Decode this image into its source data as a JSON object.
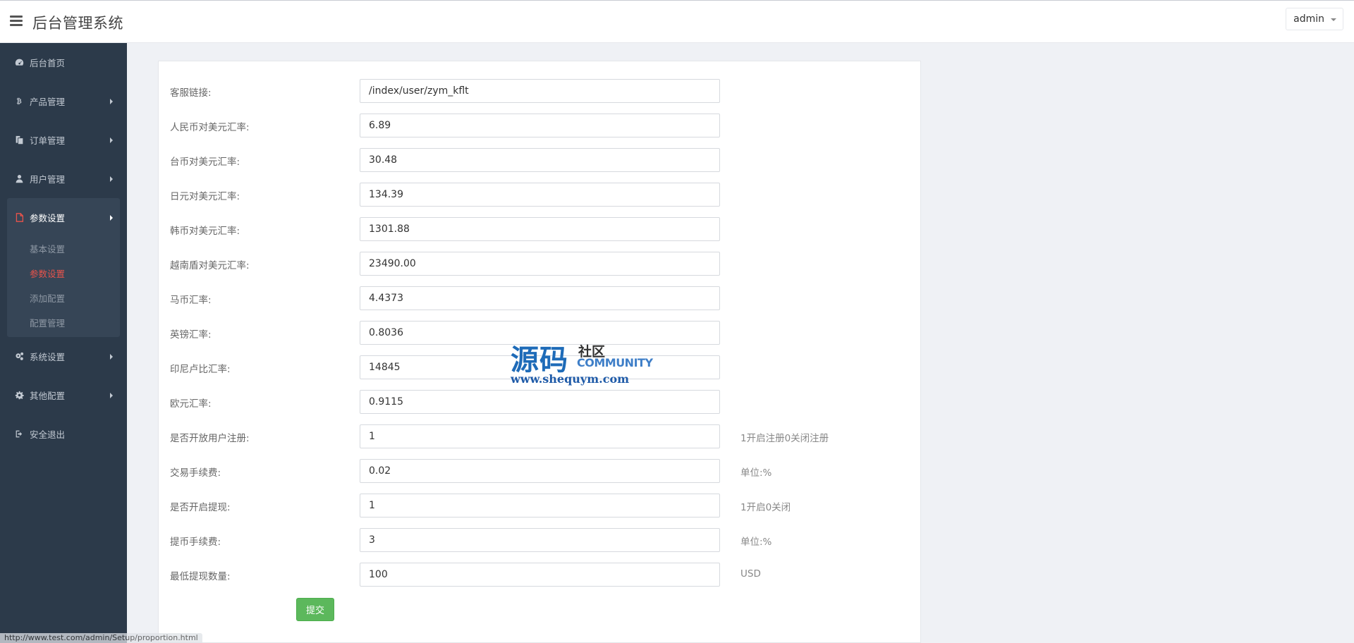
{
  "header": {
    "title": "后台管理系统",
    "user": "admin"
  },
  "sidebar": {
    "items": [
      {
        "label": "后台首页",
        "icon": "dashboard-icon",
        "has_arrow": false
      },
      {
        "label": "产品管理",
        "icon": "bitcoin-icon",
        "has_arrow": true
      },
      {
        "label": "订单管理",
        "icon": "copy-icon",
        "has_arrow": true
      },
      {
        "label": "用户管理",
        "icon": "user-icon",
        "has_arrow": true
      }
    ],
    "active_group": {
      "label": "参数设置",
      "icon": "file-icon",
      "subitems": [
        {
          "label": "基本设置",
          "active": false
        },
        {
          "label": "参数设置",
          "active": true
        },
        {
          "label": "添加配置",
          "active": false
        },
        {
          "label": "配置管理",
          "active": false
        }
      ]
    },
    "items_after": [
      {
        "label": "系统设置",
        "icon": "gears-icon",
        "has_arrow": true
      },
      {
        "label": "其他配置",
        "icon": "gear-icon",
        "has_arrow": true
      },
      {
        "label": "安全退出",
        "icon": "sign-out-icon",
        "has_arrow": false
      }
    ]
  },
  "form": {
    "fields": [
      {
        "label": "客服链接:",
        "value": "/index/user/zym_kflt",
        "hint": ""
      },
      {
        "label": "人民币对美元汇率:",
        "value": "6.89",
        "hint": ""
      },
      {
        "label": "台币对美元汇率:",
        "value": "30.48",
        "hint": ""
      },
      {
        "label": "日元对美元汇率:",
        "value": "134.39",
        "hint": ""
      },
      {
        "label": "韩币对美元汇率:",
        "value": "1301.88",
        "hint": ""
      },
      {
        "label": "越南盾对美元汇率:",
        "value": "23490.00",
        "hint": ""
      },
      {
        "label": "马币汇率:",
        "value": "4.4373",
        "hint": ""
      },
      {
        "label": "英镑汇率:",
        "value": "0.8036",
        "hint": ""
      },
      {
        "label": "印尼卢比汇率:",
        "value": "14845",
        "hint": ""
      },
      {
        "label": "欧元汇率:",
        "value": "0.9115",
        "hint": ""
      },
      {
        "label": "是否开放用户注册:",
        "value": "1",
        "hint": "1开启注册0关闭注册"
      },
      {
        "label": "交易手续费:",
        "value": "0.02",
        "hint": "单位:%"
      },
      {
        "label": "是否开启提现:",
        "value": "1",
        "hint": "1开启0关闭"
      },
      {
        "label": "提币手续费:",
        "value": "3",
        "hint": "单位:%"
      },
      {
        "label": "最低提现数量:",
        "value": "100",
        "hint": "USD"
      }
    ],
    "submit_label": "提交"
  },
  "watermark": {
    "main": "源码",
    "sub": "社区",
    "en": "COMMUNITY",
    "url": "www.shequym.com"
  },
  "status_bar": {
    "text": "http://www.test.com/admin/Setup/proportion.html"
  }
}
